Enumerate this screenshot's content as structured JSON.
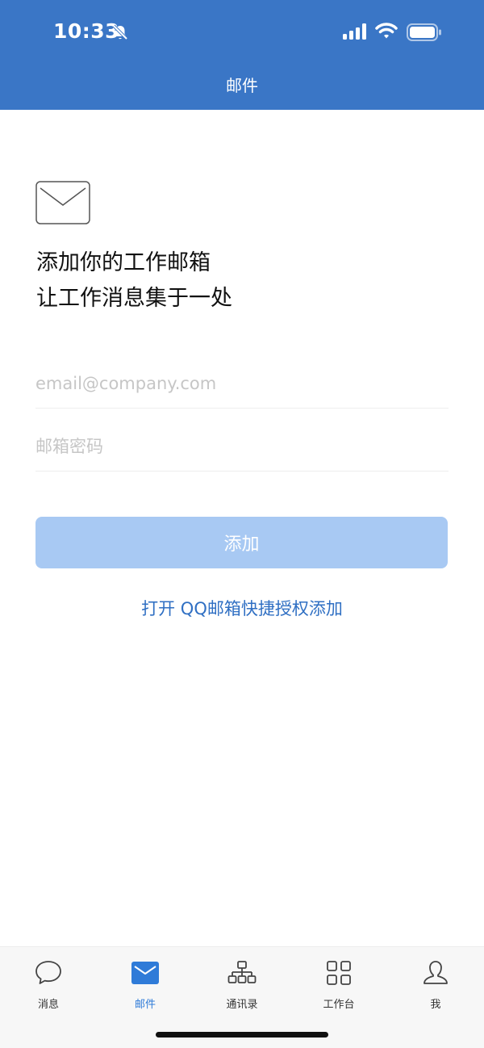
{
  "status_bar": {
    "time": "10:33"
  },
  "header": {
    "title": "邮件"
  },
  "main": {
    "headline_line1": "添加你的工作邮箱",
    "headline_line2": "让工作消息集于一处",
    "email_placeholder": "email@company.com",
    "email_value": "",
    "password_placeholder": "邮箱密码",
    "password_value": "",
    "add_button": "添加",
    "qq_link": "打开 QQ邮箱快捷授权添加"
  },
  "tabbar": {
    "active": "mail",
    "items": [
      {
        "label": "消息",
        "icon": "chat-bubble-icon"
      },
      {
        "label": "邮件",
        "icon": "mail-icon"
      },
      {
        "label": "通讯录",
        "icon": "org-chart-icon"
      },
      {
        "label": "工作台",
        "icon": "grid-icon"
      },
      {
        "label": "我",
        "icon": "person-icon"
      }
    ]
  },
  "colors": {
    "header_bg": "#3a76c6",
    "accent": "#2f7bd8",
    "button_disabled": "#a8c9f3",
    "link": "#2f6fc3"
  }
}
